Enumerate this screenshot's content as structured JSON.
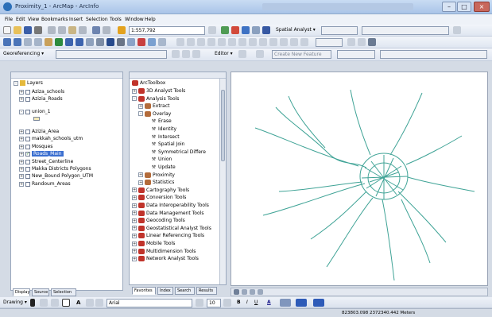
{
  "window": {
    "title": "Proximity_1 - ArcMap - ArcInfo"
  },
  "menu": [
    "File",
    "Edit",
    "View",
    "Bookmarks",
    "Insert",
    "Selection",
    "Tools",
    "Window",
    "Help"
  ],
  "toolbar": {
    "scale_value": "1:557,792",
    "spatial_analyst_label": "Spatial Analyst ▾",
    "georeferencing_label": "Georeferencing ▾",
    "editor_label": "Editor ▾",
    "create_new_feature_label": "Create New Feature"
  },
  "toc": {
    "root_label": "Layers",
    "layers": [
      {
        "label": "Aziza_schools",
        "checked": false
      },
      {
        "label": "Azizia_Roads",
        "checked": false
      },
      {
        "label": "union_1",
        "checked": false
      },
      {
        "label": "Azizia_Area",
        "checked": false
      },
      {
        "label": "makkah_schools_utm",
        "checked": false
      },
      {
        "label": "Mosques",
        "checked": false
      },
      {
        "label": "Roads_Main",
        "checked": true
      },
      {
        "label": "Street_Centerline",
        "checked": false
      },
      {
        "label": "Makka Districts Polygons",
        "checked": false
      },
      {
        "label": "New_Bound Polygon_UTM",
        "checked": false
      },
      {
        "label": "Randoum_Areas",
        "checked": false
      }
    ],
    "tabs": [
      "Display",
      "Source",
      "Selection"
    ]
  },
  "arctoolbox": {
    "root_label": "ArcToolbox",
    "items": [
      {
        "label": "3D Analyst Tools",
        "level": 1,
        "kind": "toolbox",
        "expander": "+"
      },
      {
        "label": "Analysis Tools",
        "level": 1,
        "kind": "toolbox",
        "expander": "-"
      },
      {
        "label": "Extract",
        "level": 2,
        "kind": "toolset",
        "expander": "+"
      },
      {
        "label": "Overlay",
        "level": 2,
        "kind": "toolset",
        "expander": "-"
      },
      {
        "label": "Erase",
        "level": 3,
        "kind": "tool"
      },
      {
        "label": "Identity",
        "level": 3,
        "kind": "tool"
      },
      {
        "label": "Intersect",
        "level": 3,
        "kind": "tool"
      },
      {
        "label": "Spatial Join",
        "level": 3,
        "kind": "tool"
      },
      {
        "label": "Symmetrical Differe",
        "level": 3,
        "kind": "tool"
      },
      {
        "label": "Union",
        "level": 3,
        "kind": "tool"
      },
      {
        "label": "Update",
        "level": 3,
        "kind": "tool"
      },
      {
        "label": "Proximity",
        "level": 2,
        "kind": "toolset",
        "expander": "+"
      },
      {
        "label": "Statistics",
        "level": 2,
        "kind": "toolset",
        "expander": "+"
      },
      {
        "label": "Cartography Tools",
        "level": 1,
        "kind": "toolbox",
        "expander": "+"
      },
      {
        "label": "Conversion Tools",
        "level": 1,
        "kind": "toolbox",
        "expander": "+"
      },
      {
        "label": "Data Interoperability Tools",
        "level": 1,
        "kind": "toolbox",
        "expander": "+"
      },
      {
        "label": "Data Management Tools",
        "level": 1,
        "kind": "toolbox",
        "expander": "+"
      },
      {
        "label": "Geocoding Tools",
        "level": 1,
        "kind": "toolbox",
        "expander": "+"
      },
      {
        "label": "Geostatistical Analyst Tools",
        "level": 1,
        "kind": "toolbox",
        "expander": "+"
      },
      {
        "label": "Linear Referencing Tools",
        "level": 1,
        "kind": "toolbox",
        "expander": "+"
      },
      {
        "label": "Mobile Tools",
        "level": 1,
        "kind": "toolbox",
        "expander": "+"
      },
      {
        "label": "Multidimension Tools",
        "level": 1,
        "kind": "toolbox",
        "expander": "+"
      },
      {
        "label": "Network Analyst Tools",
        "level": 1,
        "kind": "toolbox",
        "expander": "+"
      }
    ],
    "tabs": [
      "Favorites",
      "Index",
      "Search",
      "Results"
    ]
  },
  "drawing_toolbar": {
    "drawing_label": "Drawing ▾",
    "font_name": "Arial",
    "font_size": "10"
  },
  "status": {
    "coordinates": "823803.098  2372340.442 Meters"
  },
  "colors": {
    "road_line": "#3fa396",
    "highlight": "#3b6fd0",
    "toolbox_red": "#c0332b"
  }
}
